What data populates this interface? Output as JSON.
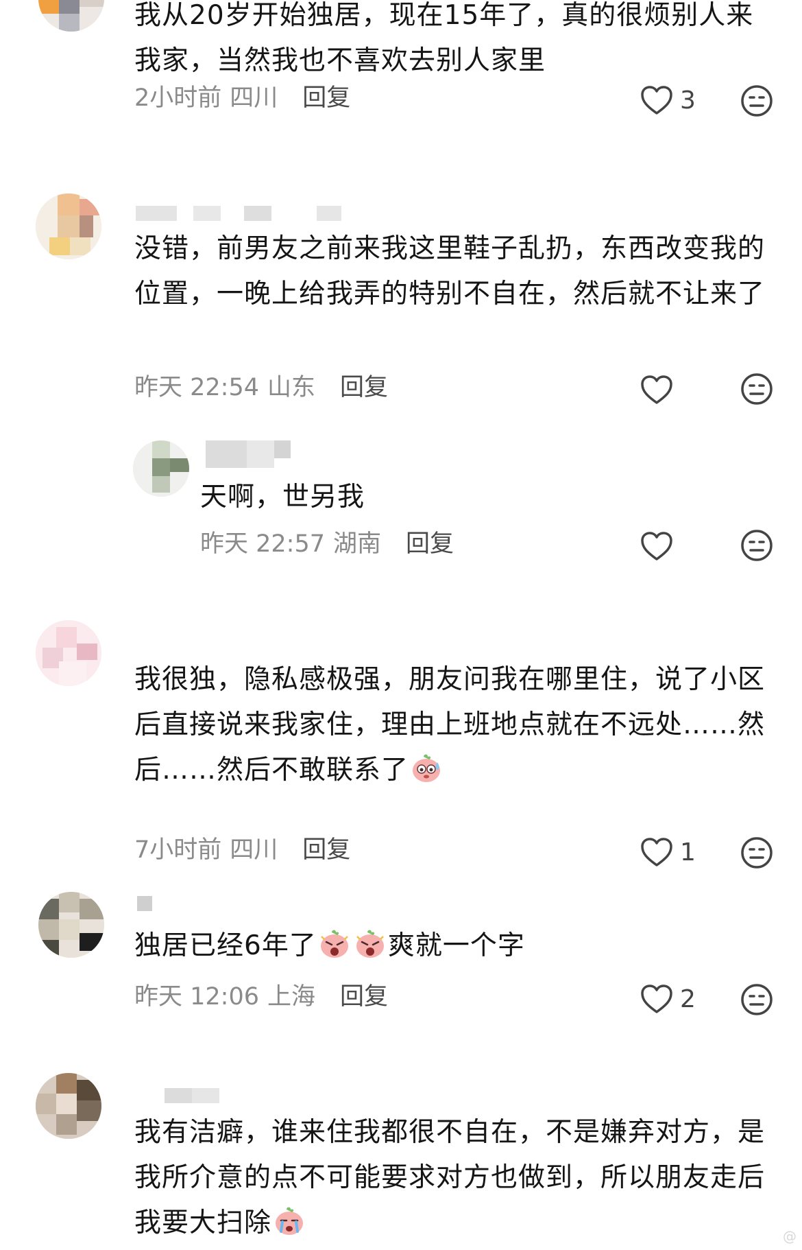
{
  "comments": [
    {
      "text": "我从20岁开始独居，现在15年了，真的很烦别人来我家，当然我也不喜欢去别人家里",
      "time": "2小时前",
      "location": "四川",
      "reply_label": "回复",
      "likes": "3"
    },
    {
      "text": "没错，前男友之前来我这里鞋子乱扔，东西改变我的位置，一晚上给我弄的特别不自在，然后就不让来了",
      "time": "昨天 22:54",
      "location": "山东",
      "reply_label": "回复",
      "likes": ""
    },
    {
      "text": "天啊，世另我",
      "time": "昨天 22:57",
      "location": "湖南",
      "reply_label": "回复",
      "likes": ""
    },
    {
      "text": "我很独，隐私感极强，朋友问我在哪里住，说了小区后直接说来我家住，理由上班地点就在不远处……然后……然后不敢联系了",
      "time": "7小时前",
      "location": "四川",
      "reply_label": "回复",
      "likes": "1"
    },
    {
      "text_before": "独居已经6年了",
      "text_after": "爽就一个字",
      "time": "昨天 12:06",
      "location": "上海",
      "reply_label": "回复",
      "likes": "2"
    },
    {
      "text": "我有洁癖，谁来住我都很不自在，不是嫌弃对方，是我所介意的点不可能要求对方也做到，所以朋友走后我要大扫除"
    }
  ],
  "icons": {
    "like": "heart-outline-icon",
    "dislike": "neutral-face-icon",
    "emoji_sweat": "sweat-emoji-icon",
    "emoji_shock": "shocked-emoji-icon",
    "emoji_cry": "crying-emoji-icon"
  },
  "colors": {
    "text": "#151515",
    "meta": "#8a8a8a",
    "reply": "#4a4a4a",
    "emoji": "#f3a3a0"
  }
}
